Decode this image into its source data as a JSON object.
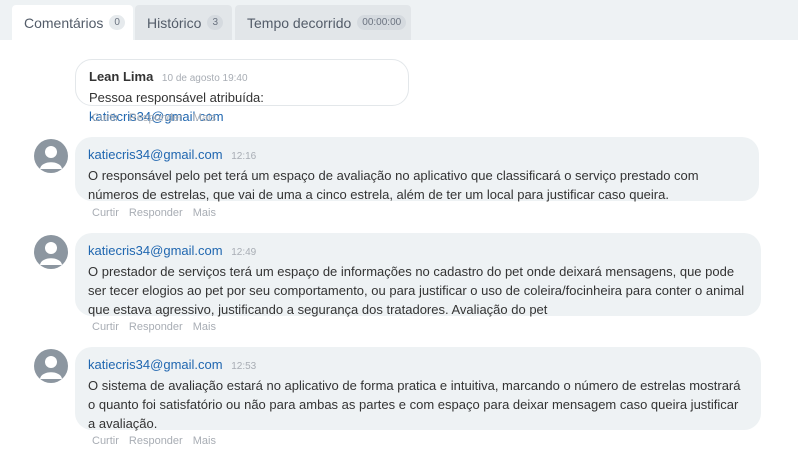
{
  "tabs": [
    {
      "label": "Comentários",
      "badge": "0"
    },
    {
      "label": "Histórico",
      "badge": "3"
    },
    {
      "label": "Tempo decorrido",
      "badge": "00:00:00"
    }
  ],
  "system_comment": {
    "author": "Lean Lima",
    "time": "10 de agosto 19:40",
    "text_prefix": "Pessoa responsável atribuída: ",
    "text_link": "katiecris34@gmail.com"
  },
  "actions": {
    "like": "Curtir",
    "reply": "Responder",
    "more": "Mais"
  },
  "comments": [
    {
      "author": "katiecris34@gmail.com",
      "time": "12:16",
      "text": "O responsável pelo pet terá um espaço de avaliação no aplicativo que classificará o serviço prestado com números de estrelas, que vai de uma a cinco estrela, além de ter um local para justificar caso queira."
    },
    {
      "author": "katiecris34@gmail.com",
      "time": "12:49",
      "text": "O prestador de serviços terá um espaço de informações no cadastro do pet onde deixará mensagens, que pode ser tecer elogios ao pet por seu comportamento, ou para justificar o uso de coleira/focinheira para conter o animal que estava agressivo, justificando a segurança dos tratadores. Avaliação do pet"
    },
    {
      "author": "katiecris34@gmail.com",
      "time": "12:53",
      "text": "O sistema de avaliação estará no aplicativo de forma pratica e intuitiva, marcando o número de estrelas mostrará o quanto foi satisfatório ou não para ambas as partes e com espaço para deixar mensagem caso queira justificar a avaliação."
    }
  ]
}
